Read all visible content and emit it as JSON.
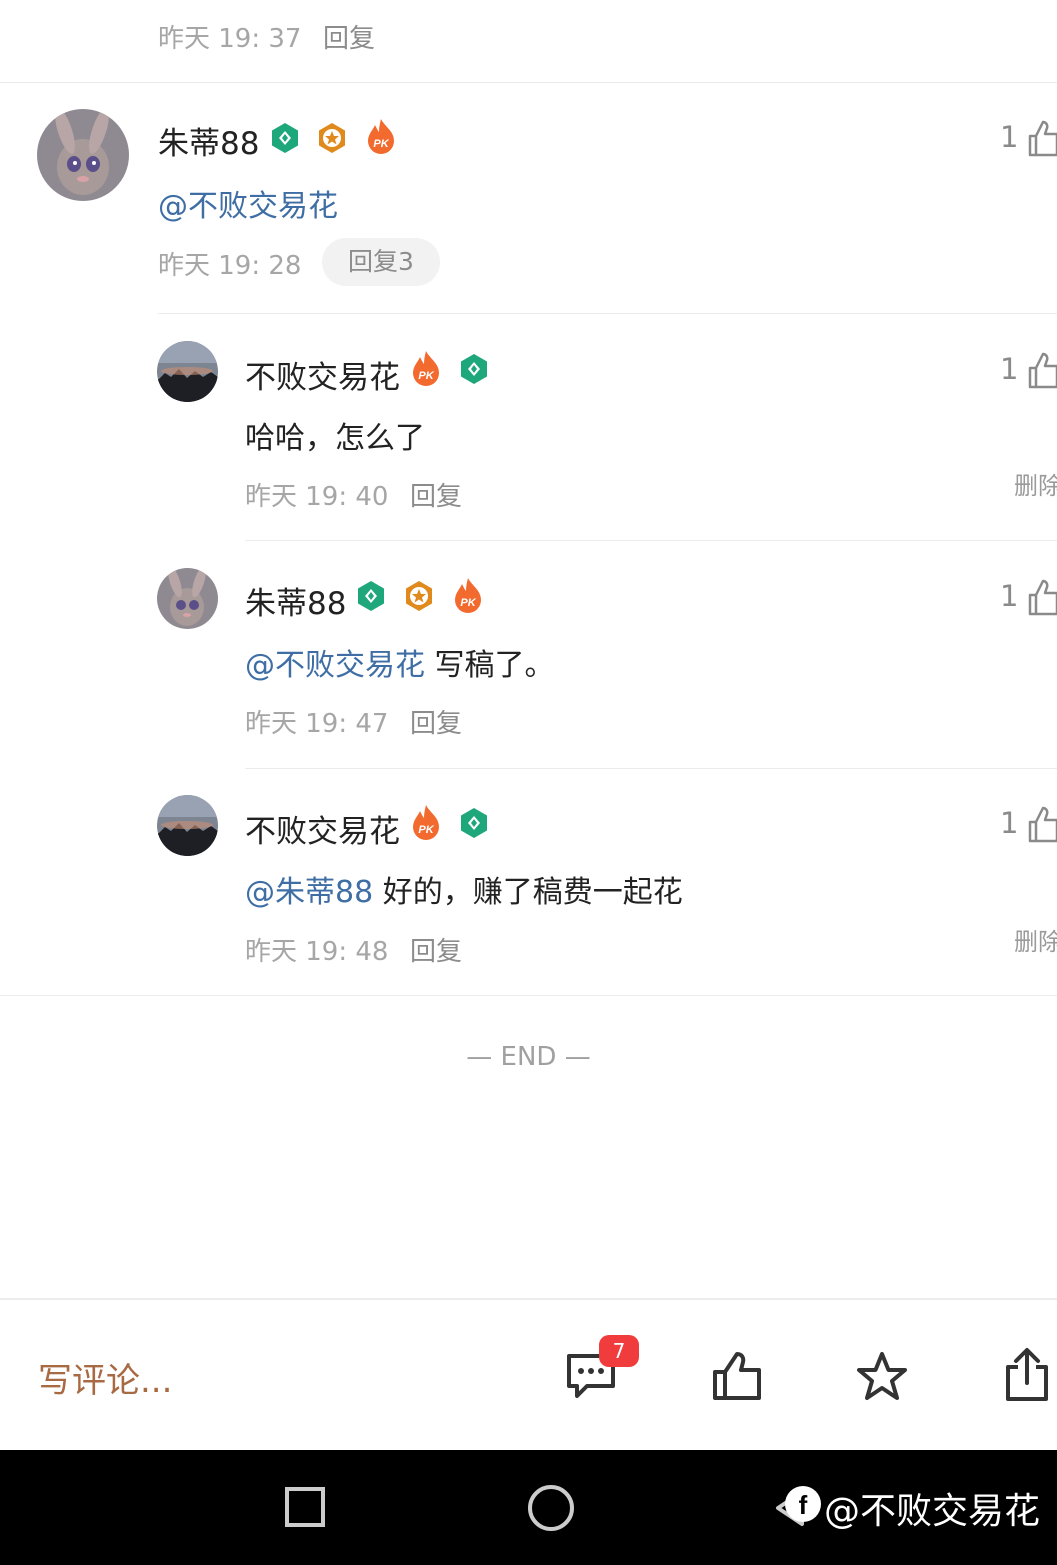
{
  "top_comment": {
    "time": "昨天 19: 37",
    "reply_label": "回复"
  },
  "main_comment": {
    "user": "朱蒂88",
    "mention": "@不败交易花",
    "time": "昨天 19: 28",
    "reply_label": "回复3",
    "likes": "1"
  },
  "replies": [
    {
      "user": "不败交易花",
      "mention": "",
      "text": "哈哈，怎么了",
      "time": "昨天 19: 40",
      "reply_label": "回复",
      "likes": "1",
      "delete_label": "删除"
    },
    {
      "user": "朱蒂88",
      "mention": "@不败交易花",
      "text": " 写稿了。",
      "time": "昨天 19: 47",
      "reply_label": "回复",
      "likes": "1",
      "delete_label": ""
    },
    {
      "user": "不败交易花",
      "mention": "@朱蒂88",
      "text": " 好的，赚了稿费一起花",
      "time": "昨天 19: 48",
      "reply_label": "回复",
      "likes": "1",
      "delete_label": "删除"
    }
  ],
  "end_label": "— END —",
  "bottom_bar": {
    "placeholder": "写评论...",
    "comment_count": "7"
  },
  "watermark": "@不败交易花",
  "icons": {
    "like": "thumbs-up-icon",
    "comment": "comment-bubble-icon",
    "favorite": "star-icon",
    "share": "share-icon",
    "badge_verified": "green-hexagon-badge-icon",
    "badge_star": "orange-star-badge-icon",
    "badge_pk": "fire-pk-badge-icon"
  },
  "colors": {
    "mention": "#3f6ea5",
    "write_comment": "#a86a43",
    "unread_badge": "#f03c3c"
  }
}
